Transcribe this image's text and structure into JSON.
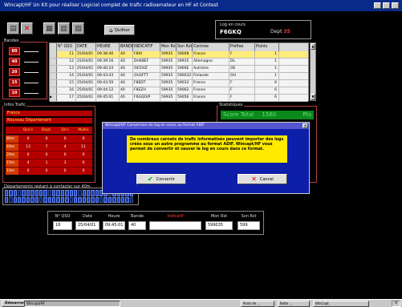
{
  "window": {
    "title": "Wincapt/HF  Un Kit pour réaliser Logiciel complet de trafic radioamateur en HF et Contest",
    "clock": "4"
  },
  "toolbar": {
    "buttons": [
      {
        "name": "print-icon",
        "glyph": "▤"
      },
      {
        "name": "delete-icon",
        "glyph": "✕"
      },
      {
        "name": "list-icon",
        "glyph": "▦"
      },
      {
        "name": "chart-icon",
        "glyph": "▥"
      },
      {
        "name": "map-icon",
        "glyph": "▧"
      }
    ],
    "quit_label": "Quitter"
  },
  "log": {
    "label": "Log en cours",
    "callsign": "F6GKQ",
    "dept_label": "Dept",
    "dept_value": "35"
  },
  "bandes": {
    "title": "Bandes",
    "items": [
      "80",
      "40",
      "20",
      "15",
      "10"
    ]
  },
  "qso_table": {
    "headers": [
      "N° QSO",
      "DATE",
      "HEURE",
      "BANDE",
      "INDICATIF",
      "Mon Rst",
      "Son Rst",
      "Contrée",
      "Préfixe",
      "Points"
    ],
    "rows": [
      [
        "11",
        "25/04/01",
        "09:38:46",
        "40",
        "F8IH",
        "59935",
        "59008",
        "France",
        "F",
        "1"
      ],
      [
        "12",
        "25/04/01",
        "09:39:16",
        "40",
        "DH4BEF",
        "59935",
        "59935",
        "Allemagne",
        "DL",
        "1"
      ],
      [
        "13",
        "25/04/01",
        "09:40:24",
        "40",
        "OE5VIZ",
        "59935",
        "5900E",
        "Autriche",
        "OE",
        "1"
      ],
      [
        "14",
        "25/04/01",
        "09:43:43",
        "40",
        "OH3FTT",
        "59935",
        "590032",
        "Finlande",
        "OH",
        "1"
      ],
      [
        "15",
        "25/04/01",
        "09:43:59",
        "40",
        "F8EDT",
        "59935",
        "59033",
        "France",
        "F",
        "6"
      ],
      [
        "16",
        "25/04/01",
        "09:44:12",
        "40",
        "F8EZH",
        "59935",
        "59062",
        "France",
        "F",
        "6"
      ],
      [
        "17",
        "25/04/01",
        "09:45:01",
        "40",
        "F6GQO/P",
        "59935",
        "59056",
        "France",
        "F",
        "6"
      ]
    ]
  },
  "info": {
    "title": "Infos Trafic",
    "bar1": "France",
    "bar2": "Nouveau Département",
    "headers": [
      "Qso's",
      "Dept.",
      "Qs's",
      "Multis"
    ],
    "rows": [
      {
        "band": "80m",
        "values": [
          "0",
          "0",
          "0",
          "0"
        ]
      },
      {
        "band": "40m",
        "values": [
          "13",
          "7",
          "4",
          "11"
        ]
      },
      {
        "band": "20m",
        "values": [
          "0",
          "0",
          "0",
          "0"
        ]
      },
      {
        "band": "15m",
        "values": [
          "4",
          "1",
          "3",
          "6"
        ]
      },
      {
        "band": "10m",
        "values": [
          "0",
          "0",
          "0",
          "0"
        ]
      }
    ]
  },
  "stats": {
    "title": "Statistiques",
    "score_label": "Score Total",
    "score_value": "1560",
    "score_unit": "Pts"
  },
  "depts": {
    "title": "Départements restant à contacter sur 40m"
  },
  "entry": {
    "fields": [
      {
        "label": "N° QSO",
        "value": "18",
        "name": "qso-number-field",
        "color": "#ddd"
      },
      {
        "label": "Date",
        "value": "25/04/01",
        "name": "date-field",
        "color": "#ddd"
      },
      {
        "label": "Heure",
        "value": "09:45:01",
        "name": "time-field",
        "color": "#ddd"
      },
      {
        "label": "Bande",
        "value": "40",
        "name": "band-field",
        "color": "#ddd"
      },
      {
        "label": "Indicatif",
        "value": "",
        "name": "callsign-field",
        "color": "#ff4040"
      },
      {
        "label": "Mon Rst",
        "value": "599035",
        "name": "my-rst-field",
        "color": "#ddd"
      },
      {
        "label": "Son Rst",
        "value": "599",
        "name": "their-rst-field",
        "color": "#ddd"
      }
    ]
  },
  "dialog": {
    "title": "Wincapt/HF   Conversion du log en cours au format ADIF",
    "message": "De nombreux carnets de trafic informatisés peuvent importer des logs créés sous un autre programme au format ADIF. Wincapt/HF vous permet de convertir et sauver le log en cours dans ce format.",
    "convert_label": "Convertir",
    "cancel_label": "Cancel"
  },
  "taskbar": {
    "start_label": "Démarrer",
    "items": [
      "Wincapt/HF",
      "Point de ...",
      "Boîte ...",
      "WinCapt"
    ]
  }
}
